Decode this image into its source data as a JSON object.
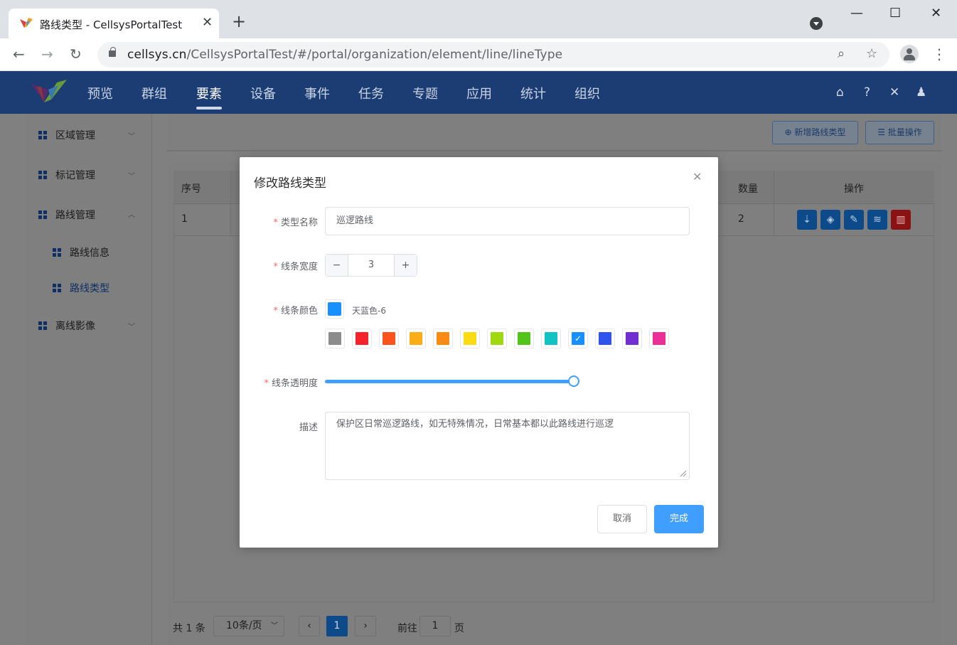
{
  "browser": {
    "tab_title": "路线类型 - CellsysPortalTest",
    "tab_close": "✕",
    "new_tab": "+",
    "url_host": "cellsys.cn",
    "url_path": "/CellsysPortalTest/#/portal/organization/element/line/lineType",
    "minimize": "—",
    "maximize": "☐",
    "close": "✕"
  },
  "app": {
    "nav": [
      "预览",
      "群组",
      "要素",
      "设备",
      "事件",
      "任务",
      "专题",
      "应用",
      "统计",
      "组织"
    ],
    "active_nav": "要素"
  },
  "sidebar": {
    "items": [
      {
        "label": "区域管理"
      },
      {
        "label": "标记管理"
      },
      {
        "label": "路线管理"
      },
      {
        "label": "路线信息"
      },
      {
        "label": "路线类型"
      },
      {
        "label": "离线影像"
      }
    ]
  },
  "toolbar": {
    "add_label": "新增路线类型",
    "batch_label": "批量操作"
  },
  "table": {
    "headers": {
      "index": "序号",
      "count": "数量",
      "ops": "操作"
    },
    "rows": [
      {
        "index": "1",
        "count": "2"
      }
    ]
  },
  "pagination": {
    "total": "共 1 条",
    "page_size": "10条/页",
    "current": "1",
    "goto_prefix": "前往",
    "goto_value": "1",
    "goto_suffix": "页"
  },
  "modal": {
    "title": "修改路线类型",
    "name_label": "类型名称",
    "name_value": "巡逻路线",
    "width_label": "线条宽度",
    "width_value": "3",
    "color_label": "线条颜色",
    "color_name": "天蓝色-6",
    "current_color": "#1890ff",
    "palette": [
      "#8c8c8c",
      "#f5222d",
      "#fa541c",
      "#faad14",
      "#fa8c16",
      "#fadb14",
      "#a0d911",
      "#52c41a",
      "#13c2c2",
      "#1890ff",
      "#2f54eb",
      "#722ed1",
      "#eb2f96"
    ],
    "selected_index": 9,
    "opacity_label": "线条透明度",
    "opacity_value": 1.0,
    "desc_label": "描述",
    "desc_value": "保护区日常巡逻路线，如无特殊情况，日常基本都以此路线进行巡逻",
    "cancel_label": "取消",
    "ok_label": "完成"
  }
}
